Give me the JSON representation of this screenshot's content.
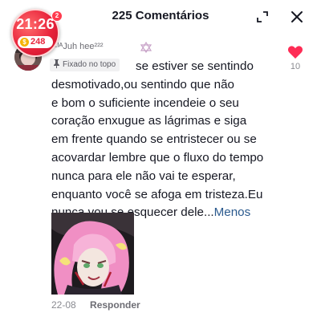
{
  "header": {
    "title": "225 Comentários"
  },
  "status_overlay": {
    "time": "21:26",
    "notification_count": "2",
    "coin_count": "248"
  },
  "comment": {
    "username": "ᴸᴵᴸᴵᴬJuh hee²²²",
    "pinned_label": "Fixado no topo",
    "text_lines": [
      "se estiver se sentindo",
      "desmotivado,ou sentindo que não",
      "e bom o suficiente incendeie o seu",
      "coração enxugue as lágrimas e siga",
      "em frente quando se entristecer ou se",
      "acovardar lembre que o fluxo do tempo",
      "nunca para ele não vai te esperar,",
      "enquanto você se afoga em tristeza.Eu",
      "nunca vou se esquecer dele..."
    ],
    "less_link": "Menos",
    "like_count": "10",
    "date": "22-08",
    "reply_label": "Responder"
  },
  "colors": {
    "accent_red": "#fe2c55",
    "link_blue": "#2b5a8e",
    "muted_text": "#8a8b91"
  }
}
